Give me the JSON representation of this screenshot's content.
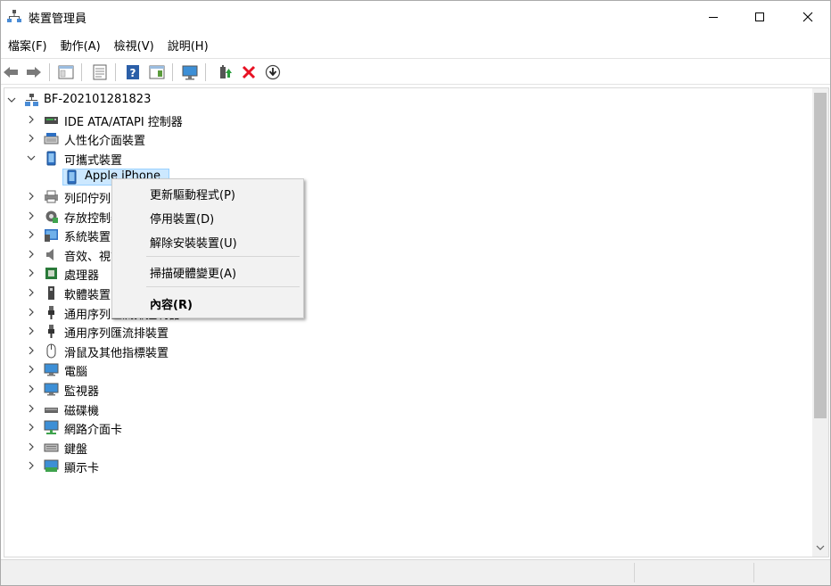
{
  "window": {
    "title": "裝置管理員"
  },
  "menubar": [
    "檔案(F)",
    "動作(A)",
    "檢視(V)",
    "說明(H)"
  ],
  "tree": {
    "root": "BF-202101281823",
    "items": [
      {
        "label": "IDE ATA/ATAPI 控制器",
        "icon": "ide-controller-icon"
      },
      {
        "label": "人性化介面裝置",
        "icon": "hid-icon"
      },
      {
        "label": "可攜式裝置",
        "icon": "portable-device-icon",
        "expanded": true
      },
      {
        "label": "Apple iPhone",
        "icon": "phone-icon",
        "child": true,
        "selected": true
      },
      {
        "label": "列印佇列",
        "icon": "printer-icon"
      },
      {
        "label": "存放控制器",
        "icon": "storage-controller-icon"
      },
      {
        "label": "系統裝置",
        "icon": "system-device-icon"
      },
      {
        "label": "音效、視訊及遊戲控制器",
        "icon": "audio-icon"
      },
      {
        "label": "處理器",
        "icon": "processor-icon"
      },
      {
        "label": "軟體裝置",
        "icon": "software-device-icon"
      },
      {
        "label": "通用序列匯流排控制器",
        "icon": "usb-icon"
      },
      {
        "label": "通用序列匯流排裝置",
        "icon": "usb-icon"
      },
      {
        "label": "滑鼠及其他指標裝置",
        "icon": "mouse-icon"
      },
      {
        "label": "電腦",
        "icon": "computer-icon"
      },
      {
        "label": "監視器",
        "icon": "monitor-icon"
      },
      {
        "label": "磁碟機",
        "icon": "disk-drive-icon"
      },
      {
        "label": "網路介面卡",
        "icon": "network-adapter-icon"
      },
      {
        "label": "鍵盤",
        "icon": "keyboard-icon"
      },
      {
        "label": "顯示卡",
        "icon": "display-adapter-icon"
      }
    ]
  },
  "context_menu": {
    "update_driver": "更新驅動程式(P)",
    "disable_device": "停用裝置(D)",
    "uninstall_device": "解除安裝裝置(U)",
    "scan_hardware": "掃描硬體變更(A)",
    "properties": "內容(R)"
  },
  "colors": {
    "selection": "#cce8ff",
    "menu_bg": "#f2f2f2",
    "accent_blue": "#1f6fc5",
    "delete_red": "#e81123"
  }
}
